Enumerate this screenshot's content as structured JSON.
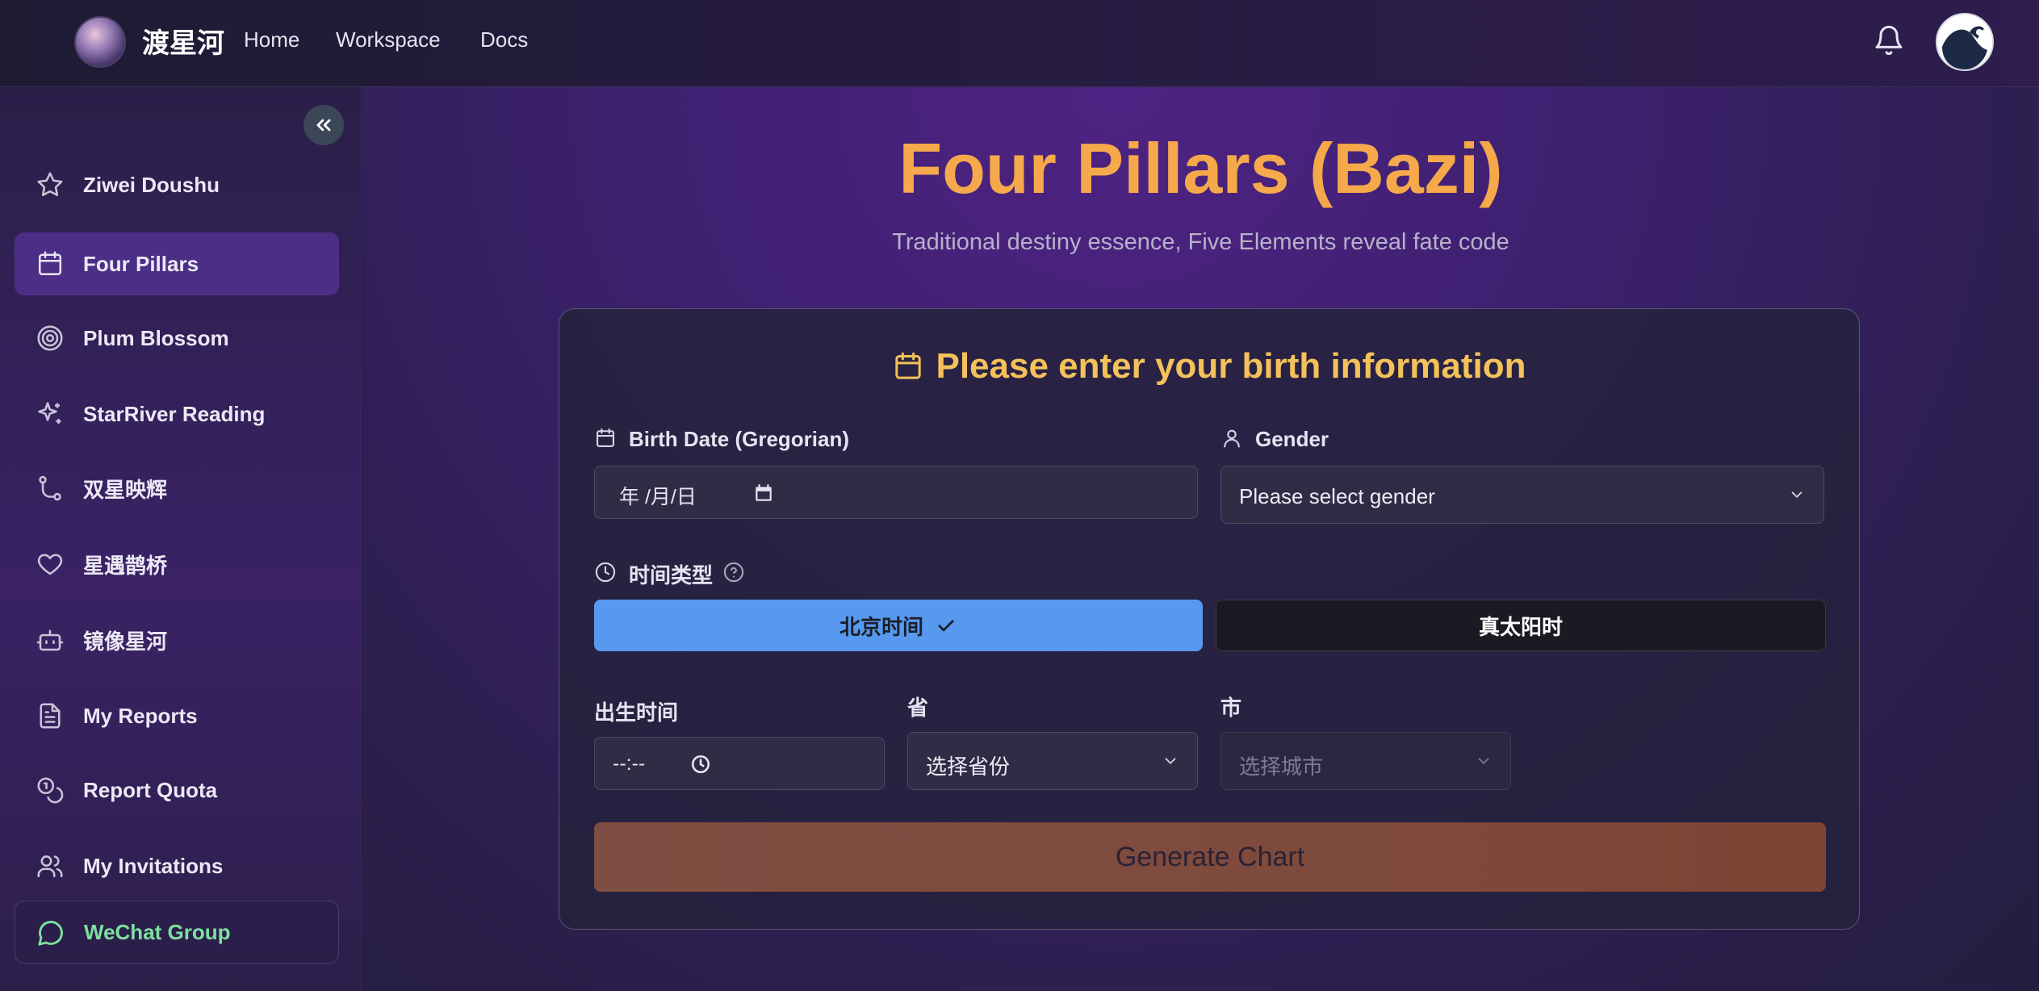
{
  "header": {
    "brand": "渡星河",
    "nav": [
      "Home",
      "Workspace",
      "Docs"
    ]
  },
  "sidebar": {
    "items": [
      {
        "label": "Ziwei Doushu",
        "icon": "star-icon"
      },
      {
        "label": "Four Pillars",
        "icon": "calendar-icon",
        "active": true
      },
      {
        "label": "Plum Blossom",
        "icon": "target-icon"
      },
      {
        "label": "StarRiver Reading",
        "icon": "sparkles-icon"
      },
      {
        "label": "双星映辉",
        "icon": "git-branch-icon"
      },
      {
        "label": "星遇鹊桥",
        "icon": "heart-icon"
      },
      {
        "label": "镜像星河",
        "icon": "bot-icon"
      },
      {
        "label": "My Reports",
        "icon": "document-icon"
      },
      {
        "label": "Report Quota",
        "icon": "coins-icon"
      },
      {
        "label": "My Invitations",
        "icon": "users-icon"
      }
    ],
    "wechat": {
      "label": "WeChat Group",
      "icon": "message-circle-icon"
    }
  },
  "page": {
    "title": "Four Pillars (Bazi)",
    "subtitle": "Traditional destiny essence, Five Elements reveal fate code"
  },
  "form": {
    "heading": "Please enter your birth information",
    "birth_date": {
      "label": "Birth Date (Gregorian)",
      "value": "年 /月/日"
    },
    "gender": {
      "label": "Gender",
      "placeholder": "Please select gender"
    },
    "time_type": {
      "label": "时间类型",
      "options": [
        "北京时间",
        "真太阳时"
      ],
      "selected": "北京时间"
    },
    "birth_time": {
      "label": "出生时间",
      "value": "--:--"
    },
    "province": {
      "label": "省",
      "placeholder": "选择省份"
    },
    "city": {
      "label": "市",
      "placeholder": "选择城市"
    },
    "submit_label": "Generate Chart"
  },
  "colors": {
    "accent_title": "#f6a94a",
    "card_heading": "#f4c15a",
    "active_toggle": "#5799ee",
    "submit_button": "#7e4a3c",
    "wechat_green": "#7ee0a0"
  }
}
